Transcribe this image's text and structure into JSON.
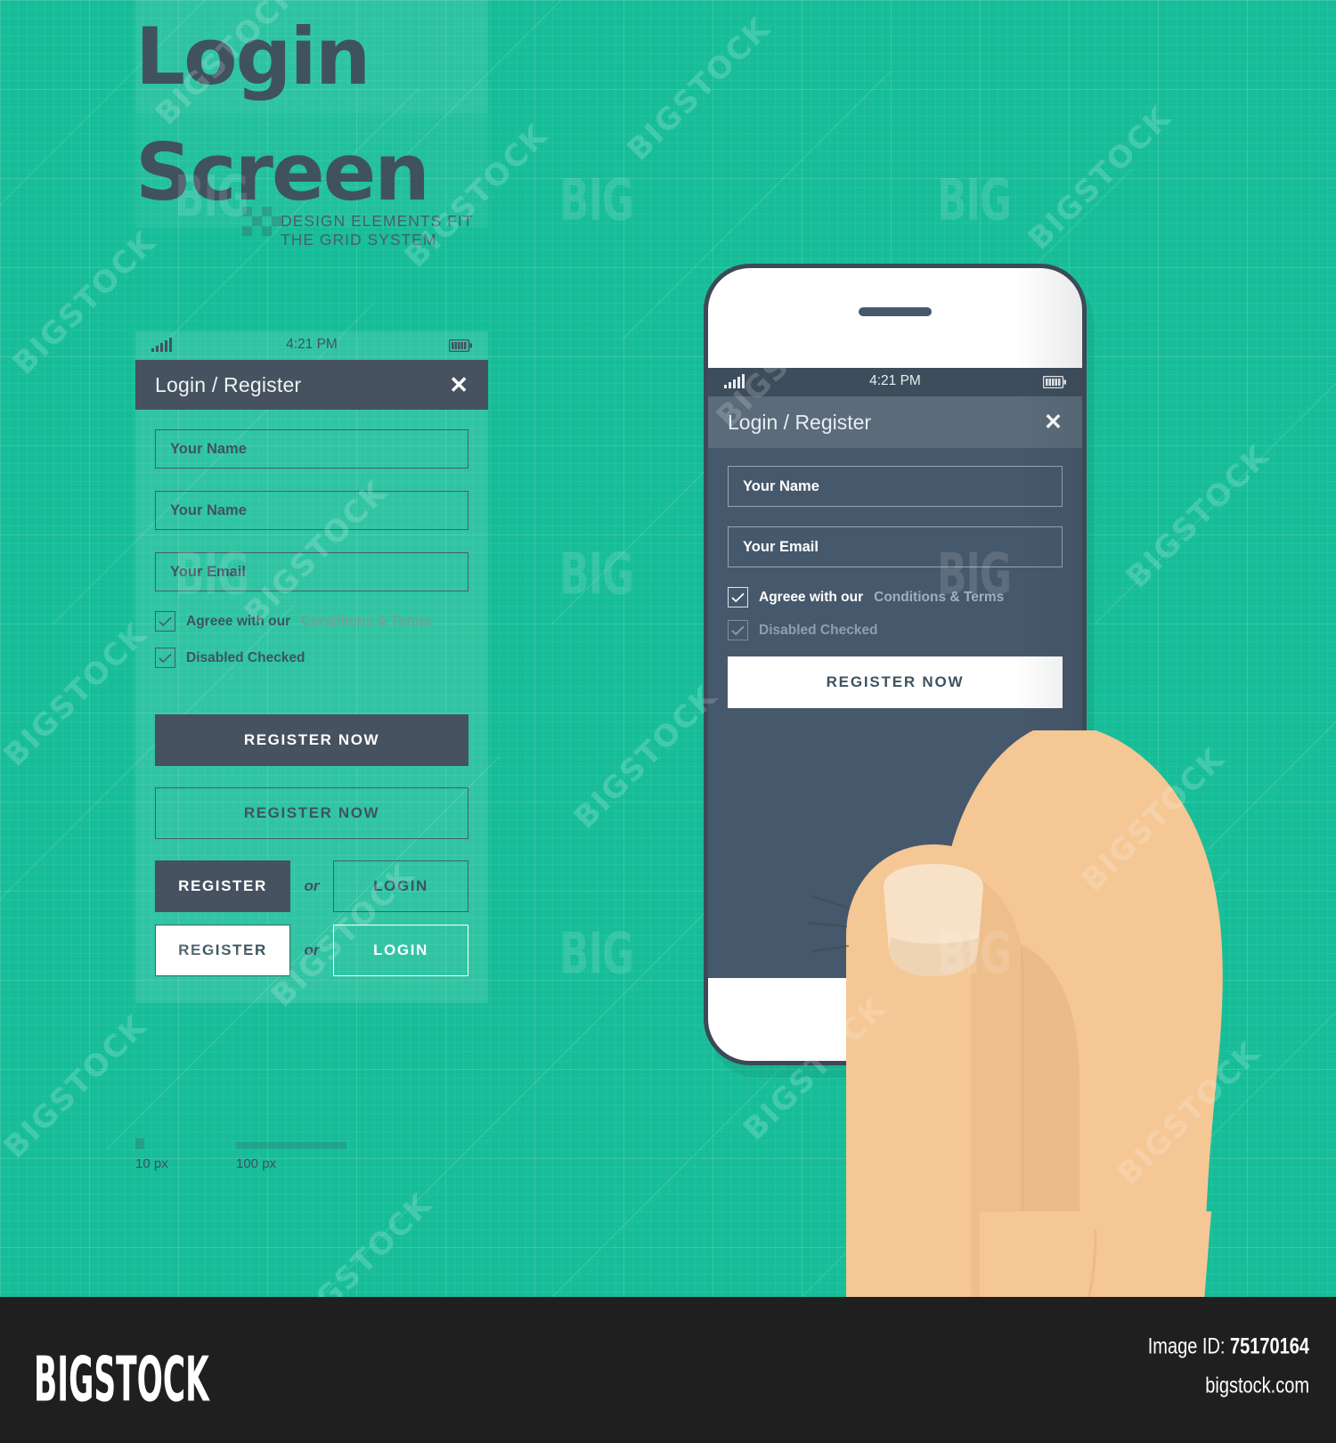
{
  "colors": {
    "background_teal": "#17BD98",
    "dark_slate": "#46586B",
    "appbar_slate": "#5B6B7A",
    "statusbar_slate": "#3E4D5C",
    "flat_button_dark": "#46525F",
    "skin": "#F5C795",
    "nail": "#F7E2C8",
    "footer_dark": "#1F1F1F"
  },
  "title": {
    "line1": "Login",
    "line2": "Screen",
    "subtitle": "DESIGN ELEMENTS FIT THE GRID SYSTEM"
  },
  "status_bar": {
    "time": "4:21 PM",
    "signal_icon": "signal-bars-icon",
    "battery_icon": "battery-full-icon"
  },
  "app_bar": {
    "title": "Login / Register",
    "close_icon": "close-icon"
  },
  "flat_mockup": {
    "fields": [
      {
        "placeholder": "Your Name"
      },
      {
        "placeholder": "Your Name"
      },
      {
        "placeholder": "Your Email"
      }
    ],
    "checkboxes": [
      {
        "label_strong": "Agreee with our",
        "label_link": "Conditions & Terms",
        "checked": true,
        "state": "enabled"
      },
      {
        "label_strong": "Disabled Checked",
        "label_link": "",
        "checked": true,
        "state": "enabled"
      }
    ],
    "buttons": {
      "register_now_solid": "REGISTER NOW",
      "register_now_outline": "REGISTER NOW",
      "register_solid": "REGISTER",
      "register_white": "REGISTER",
      "login_outline": "LOGIN",
      "login_outline_white": "LOGIN",
      "or": "or"
    }
  },
  "phone_mockup": {
    "fields": [
      {
        "placeholder": "Your Name"
      },
      {
        "placeholder": "Your Email"
      }
    ],
    "checkboxes": [
      {
        "label_strong": "Agreee with our",
        "label_link": "Conditions & Terms",
        "checked": true,
        "state": "enabled"
      },
      {
        "label_strong": "Disabled Checked",
        "label_link": "",
        "checked": true,
        "state": "disabled"
      }
    ],
    "register_button": "REGISTER NOW"
  },
  "scale": {
    "small_label": "10 px",
    "large_label": "100 px"
  },
  "watermarks": {
    "diagonal": "BIGSTOCK",
    "small": "BIG"
  },
  "footer": {
    "logo": "BIGSTOCK",
    "image_id_label": "Image ID:",
    "image_id_value": "75170164",
    "url": "bigstock.com"
  }
}
